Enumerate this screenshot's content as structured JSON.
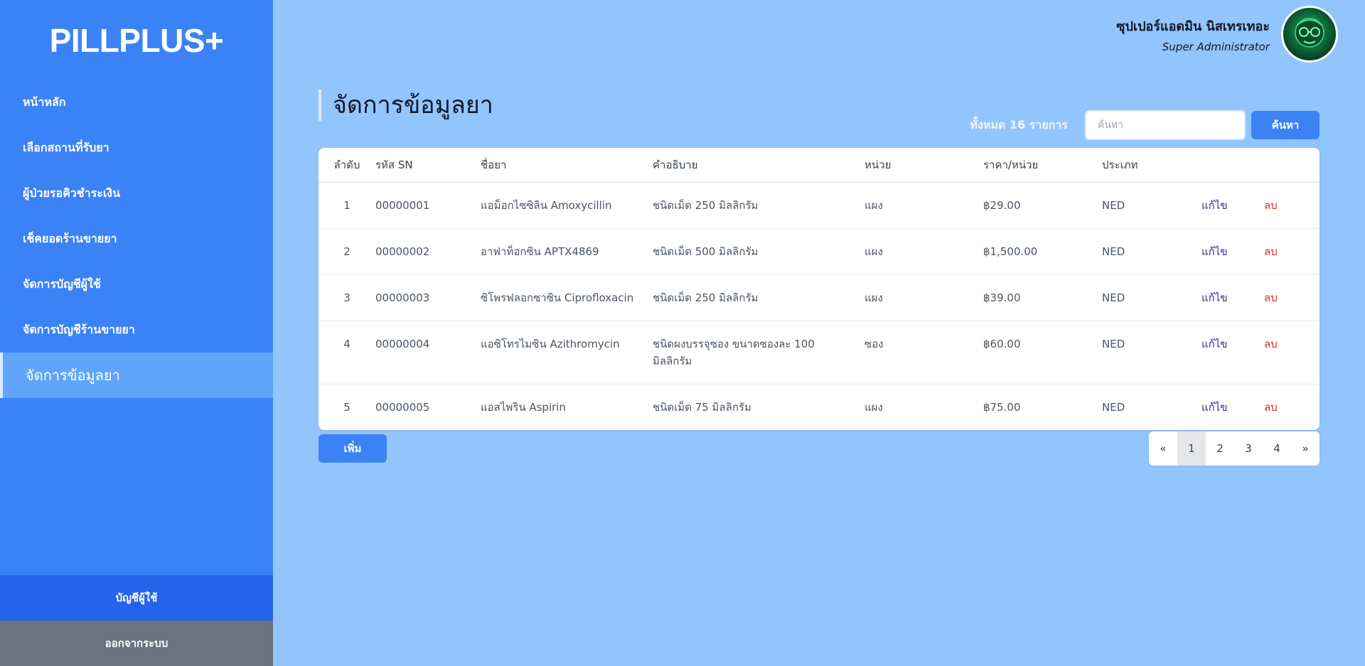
{
  "app": {
    "logo": "PILLPLUS+"
  },
  "sidebar": {
    "items": [
      {
        "label": "หน้าหลัก"
      },
      {
        "label": "เลือกสถานที่รับยา"
      },
      {
        "label": "ผู้ป่วยรอคิวชำระเงิน"
      },
      {
        "label": "เช็คยอดร้านขายยา"
      },
      {
        "label": "จัดการบัญชีผู้ใช้"
      },
      {
        "label": "จัดการบัญชีร้านขายยา"
      },
      {
        "label": "จัดการข้อมูลยา",
        "active": true
      }
    ],
    "account_label": "บัญชีผู้ใช้",
    "logout_label": "ออกจากระบบ"
  },
  "user": {
    "name": "ซุปเปอร์แอดมิน นิสเทรเทอะ",
    "role": "Super Administrator"
  },
  "main": {
    "title": "จัดการข้อมูลยา",
    "total_text": "ทั้งหมด 16 รายการ",
    "search": {
      "placeholder": "ค้นหา",
      "button_label": "ค้นหา"
    },
    "table": {
      "headers": [
        "ลำดับ",
        "รหัส SN",
        "ชื่อยา",
        "คำอธิบาย",
        "หน่วย",
        "ราคา/หน่วย",
        "ประเภท"
      ],
      "rows": [
        {
          "no": "1",
          "sn": "00000001",
          "name": "แอม็อกไซซิลิน Amoxycillin",
          "desc": "ชนิดเม็ด 250 มิลลิกรัม",
          "unit": "แผง",
          "price": "฿29.00",
          "type": "NED",
          "edit": "แก้ไข",
          "del": "ลบ"
        },
        {
          "no": "2",
          "sn": "00000002",
          "name": "อาฟาท็อกซิน APTX4869",
          "desc": "ชนิดเม็ด 500 มิลลิกรัม",
          "unit": "แผง",
          "price": "฿1,500.00",
          "type": "NED",
          "edit": "แก้ไข",
          "del": "ลบ"
        },
        {
          "no": "3",
          "sn": "00000003",
          "name": "ซิโพรฟลอกซาซิน Ciprofloxacin",
          "desc": "ชนิดเม็ด 250 มิลลิกรัม",
          "unit": "แผง",
          "price": "฿39.00",
          "type": "NED",
          "edit": "แก้ไข",
          "del": "ลบ"
        },
        {
          "no": "4",
          "sn": "00000004",
          "name": "แอซิโทรไมซิน Azithromycin",
          "desc": "ชนิดผงบรรจุซอง ขนาดซองละ 100 มิลลิกรัม",
          "unit": "ซอง",
          "price": "฿60.00",
          "type": "NED",
          "edit": "แก้ไข",
          "del": "ลบ"
        },
        {
          "no": "5",
          "sn": "00000005",
          "name": "แอสไพริน Aspirin",
          "desc": "ชนิดเม็ด 75 มิลลิกรัม",
          "unit": "แผง",
          "price": "฿75.00",
          "type": "NED",
          "edit": "แก้ไข",
          "del": "ลบ"
        }
      ]
    },
    "add_label": "เพิ่ม",
    "pagination": {
      "prev": "«",
      "pages": [
        "1",
        "2",
        "3",
        "4"
      ],
      "current": "1",
      "next": "»"
    }
  },
  "colors": {
    "sidebar": "#3b82f6",
    "sidebar_active": "#60a5fa",
    "page_bg": "#93c5fd",
    "edit_link": "#3730a3",
    "delete_link": "#dc2626"
  }
}
